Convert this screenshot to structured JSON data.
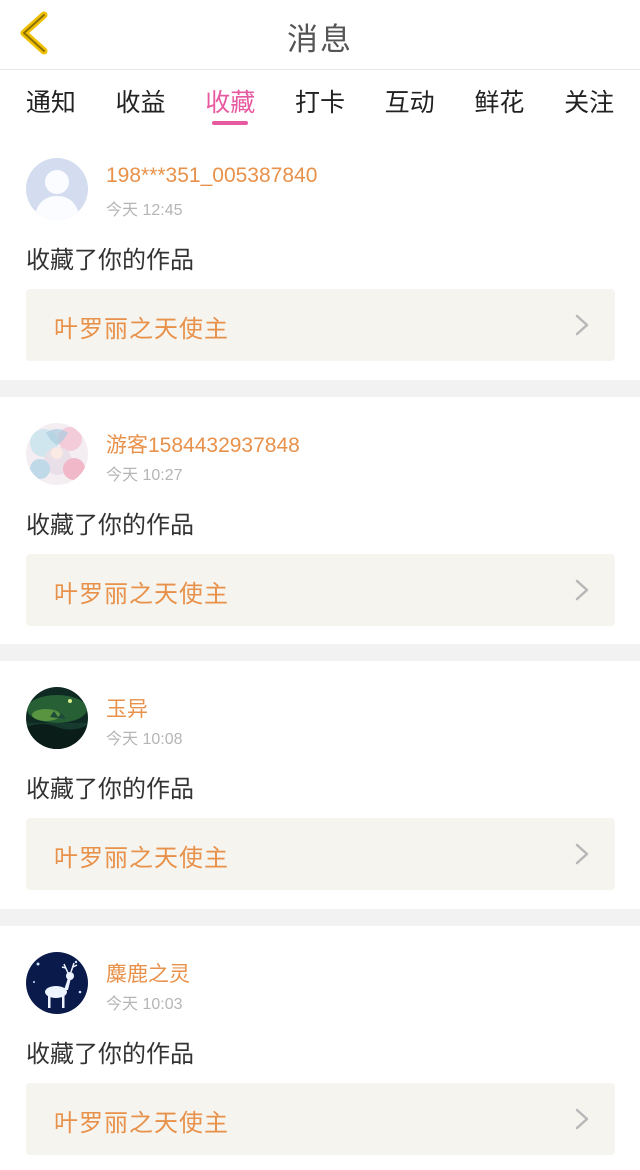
{
  "header": {
    "title": "消息",
    "back_icon": "chevron-left-icon"
  },
  "tabs": [
    {
      "label": "通知",
      "active": false
    },
    {
      "label": "收益",
      "active": false
    },
    {
      "label": "收藏",
      "active": true
    },
    {
      "label": "打卡",
      "active": false
    },
    {
      "label": "互动",
      "active": false
    },
    {
      "label": "鲜花",
      "active": false
    },
    {
      "label": "关注",
      "active": false
    }
  ],
  "colors": {
    "accent_pink": "#e85aa0",
    "username_orange": "#e8914a",
    "card_bg": "#f5f4ee",
    "back_icon_yellow": "#f0c000"
  },
  "items": [
    {
      "username": "198***351_005387840",
      "time": "今天 12:45",
      "action": "收藏了你的作品",
      "work_title": "叶罗丽之天使主",
      "avatar": "default-avatar"
    },
    {
      "username": "游客1584432937848",
      "time": "今天 10:27",
      "action": "收藏了你的作品",
      "work_title": "叶罗丽之天使主",
      "avatar": "anime-girl-avatar"
    },
    {
      "username": "玉异",
      "time": "今天 10:08",
      "action": "收藏了你的作品",
      "work_title": "叶罗丽之天使主",
      "avatar": "green-night-scene-avatar"
    },
    {
      "username": "麋鹿之灵",
      "time": "今天 10:03",
      "action": "收藏了你的作品",
      "work_title": "叶罗丽之天使主",
      "avatar": "white-deer-avatar"
    }
  ]
}
